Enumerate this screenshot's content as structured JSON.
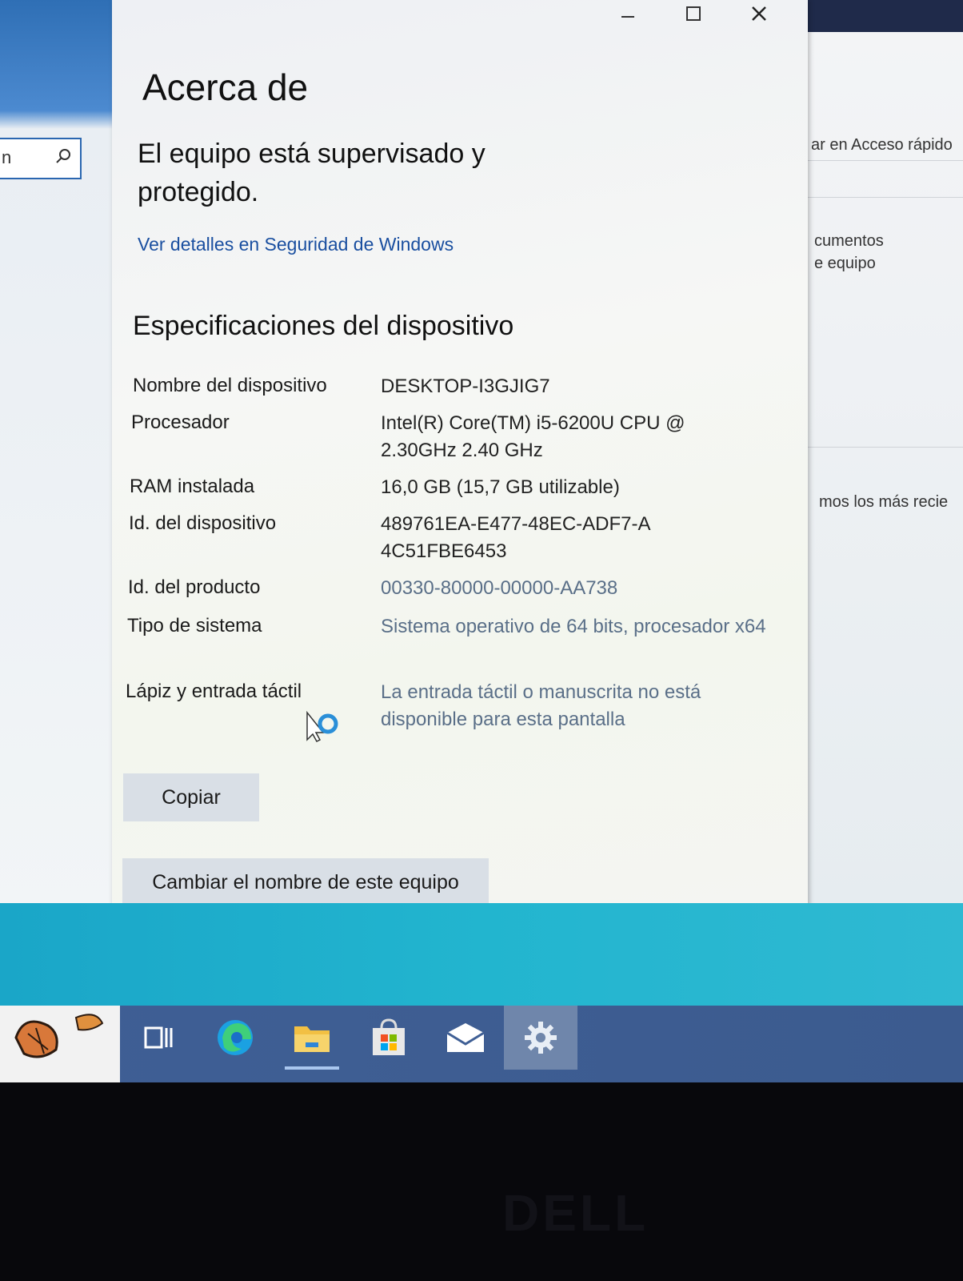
{
  "background": {
    "left_search_fragment": "n",
    "right_window": {
      "line1": "ar en Acceso rápido",
      "line2": "cumentos",
      "line3": "e equipo",
      "line4": "mos los más recie"
    }
  },
  "dialog": {
    "title": "Acerca de",
    "status": "El equipo está supervisado y protegido.",
    "security_link": "Ver detalles en Seguridad de Windows",
    "section_title": "Especificaciones del dispositivo",
    "specs": [
      {
        "label": "Nombre del dispositivo",
        "value": "DESKTOP-I3GJIG7"
      },
      {
        "label": "Procesador",
        "value": "Intel(R) Core(TM) i5-6200U CPU @ 2.30GHz   2.40 GHz"
      },
      {
        "label": "RAM instalada",
        "value": "16,0 GB (15,7 GB utilizable)"
      },
      {
        "label": "Id. del dispositivo",
        "value": "489761EA-E477-48EC-ADF7-A4C51FBE6453"
      },
      {
        "label": "Id. del producto",
        "value": "00330-80000-00000-AA738"
      },
      {
        "label": "Tipo de sistema",
        "value": "Sistema operativo de 64 bits, procesador x64"
      },
      {
        "label": "Lápiz y entrada táctil",
        "value": "La entrada táctil o manuscrita no está disponible para esta pantalla"
      }
    ],
    "copy_button": "Copiar",
    "rename_button": "Cambiar el nombre de este equipo"
  },
  "taskbar": {
    "items": [
      "task-view",
      "edge",
      "file-explorer",
      "store",
      "mail",
      "settings"
    ],
    "active": "settings"
  },
  "bezel_brand": "DELL",
  "colors": {
    "link": "#1a4fa0",
    "taskbar": "#3f5f95",
    "teal_band": "#22b5cf"
  }
}
